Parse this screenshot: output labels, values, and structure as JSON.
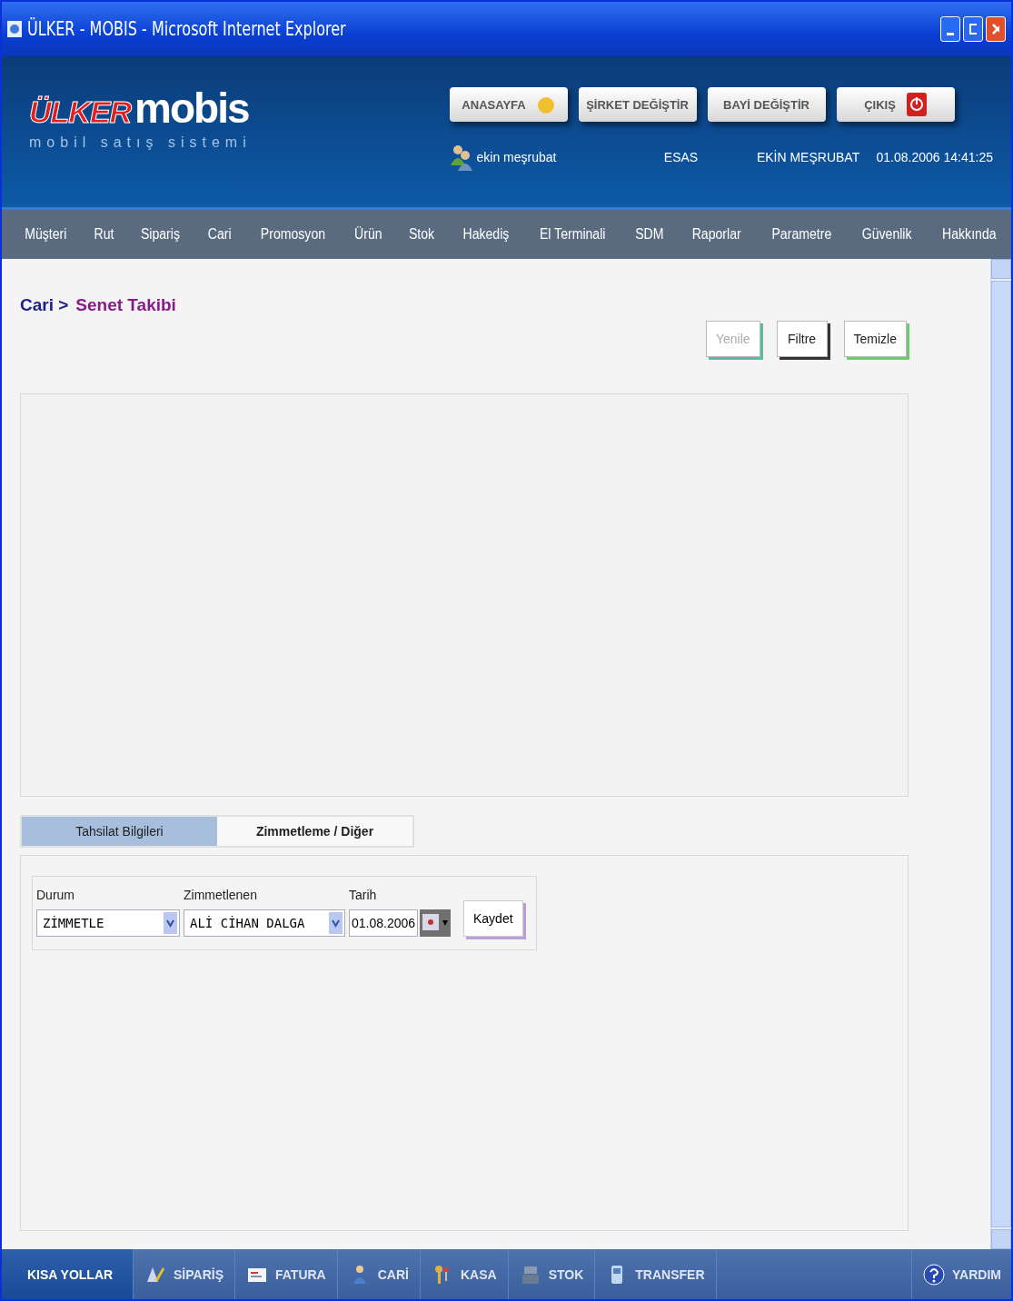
{
  "window": {
    "title": "ÜLKER - MOBIS - Microsoft Internet Explorer"
  },
  "header": {
    "logo": {
      "brand": "ÜLKER",
      "product": "mobis",
      "tagline": "mobil satış sistemi"
    },
    "buttons": [
      {
        "label": "ANASAYFA",
        "kind": "home"
      },
      {
        "label": "ŞİRKET DEĞİŞTİR",
        "kind": "plain"
      },
      {
        "label": "BAYİ DEĞİŞTİR",
        "kind": "plain"
      },
      {
        "label": "ÇIKIŞ",
        "kind": "power"
      }
    ],
    "user": "ekin meşrubat",
    "company": "ESAS",
    "dealer": "EKİN MEŞRUBAT",
    "datetime": "01.08.2006 14:41:25"
  },
  "nav": [
    "Müşteri",
    "Rut",
    "Sipariş",
    "Cari",
    "Promosyon",
    "Ürün",
    "Stok",
    "Hakediş",
    "El Terminali",
    "SDM",
    "Raporlar",
    "Parametre",
    "Güvenlik",
    "Hakkında"
  ],
  "breadcrumb": {
    "parent": "Cari >",
    "current": "Senet Takibi"
  },
  "actions": [
    {
      "label": "Yenile",
      "disabled": true
    },
    {
      "label": "Filtre",
      "disabled": false
    },
    {
      "label": "Temizle",
      "disabled": false
    }
  ],
  "tabs": [
    {
      "label": "Tahsilat Bilgileri",
      "selected": false
    },
    {
      "label": "Zimmetleme / Diğer",
      "selected": true
    }
  ],
  "form": {
    "fields": [
      {
        "label": "Durum",
        "value": "ZİMMETLE",
        "kind": "select"
      },
      {
        "label": "Zimmetlenen",
        "value": "ALİ CİHAN DALGA",
        "kind": "select"
      },
      {
        "label": "Tarih",
        "value": "01.08.2006",
        "kind": "date"
      }
    ],
    "save": "Kaydet"
  },
  "shortcuts": {
    "title": "KISA YOLLAR",
    "items": [
      {
        "label": "SİPARİŞ",
        "kind": "order"
      },
      {
        "label": "FATURA",
        "kind": "invoice"
      },
      {
        "label": "CARİ",
        "kind": "person"
      },
      {
        "label": "KASA",
        "kind": "keys"
      },
      {
        "label": "STOK",
        "kind": "stock"
      },
      {
        "label": "TRANSFER",
        "kind": "transfer"
      }
    ],
    "help": "YARDIM"
  }
}
